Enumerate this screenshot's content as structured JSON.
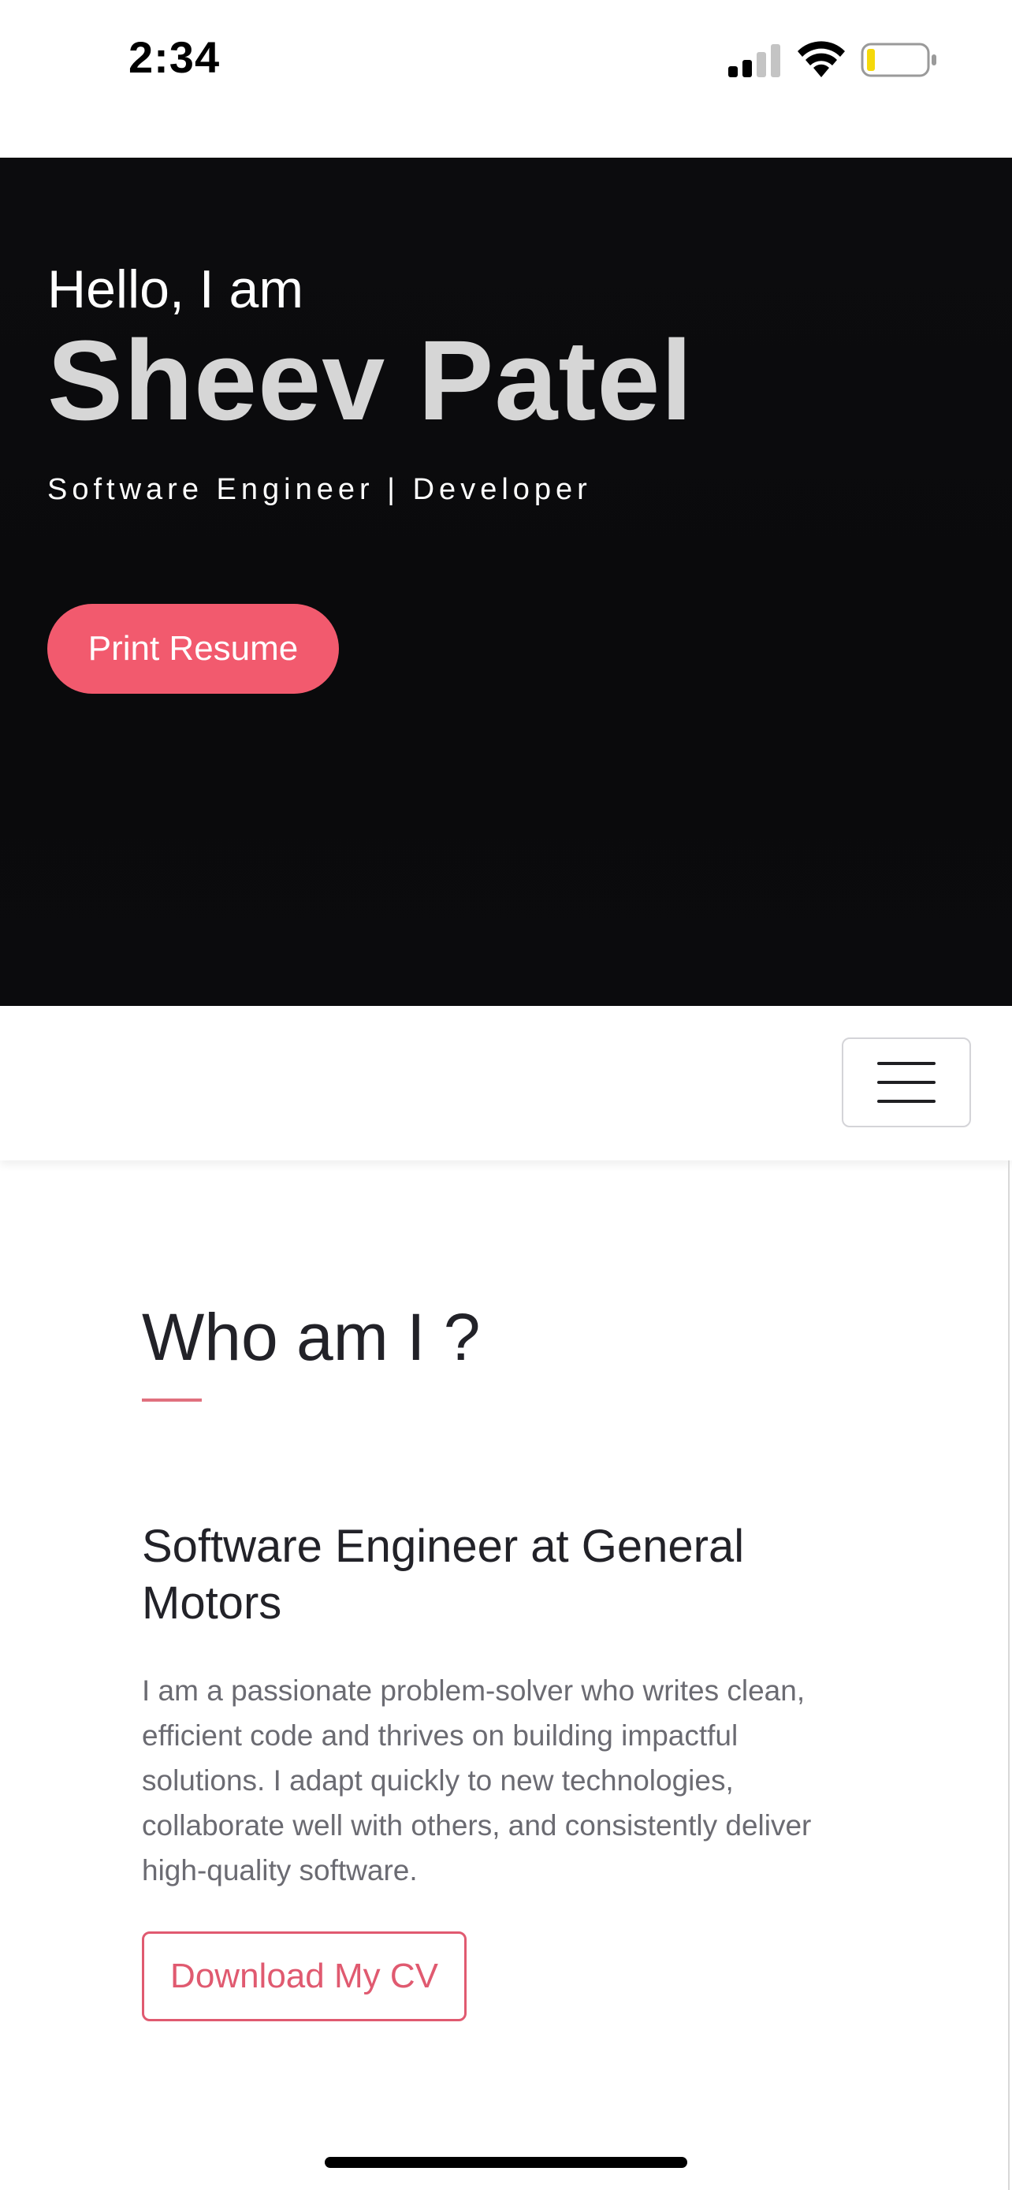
{
  "status": {
    "time": "2:34"
  },
  "hero": {
    "greeting": "Hello, I am",
    "name": "Sheev Patel",
    "subtitle": "Software Engineer | Developer",
    "print_button": "Print Resume"
  },
  "about": {
    "title": "Who am I ?",
    "role": "Software Engineer at General Motors",
    "bio": "I am a passionate problem-solver who writes clean, efficient code and thrives on building impactful solutions. I adapt quickly to new technologies, collaborate well with others, and consistently deliver high-quality software.",
    "cv_button": "Download My CV"
  },
  "icons": {
    "signal": "cellular-signal-icon",
    "wifi": "wifi-icon",
    "battery": "battery-low-icon",
    "menu": "hamburger-menu-icon"
  },
  "colors": {
    "accent": "#f25a6e",
    "hero_bg": "#0b0b0d",
    "battery_low": "#f5d90a"
  }
}
